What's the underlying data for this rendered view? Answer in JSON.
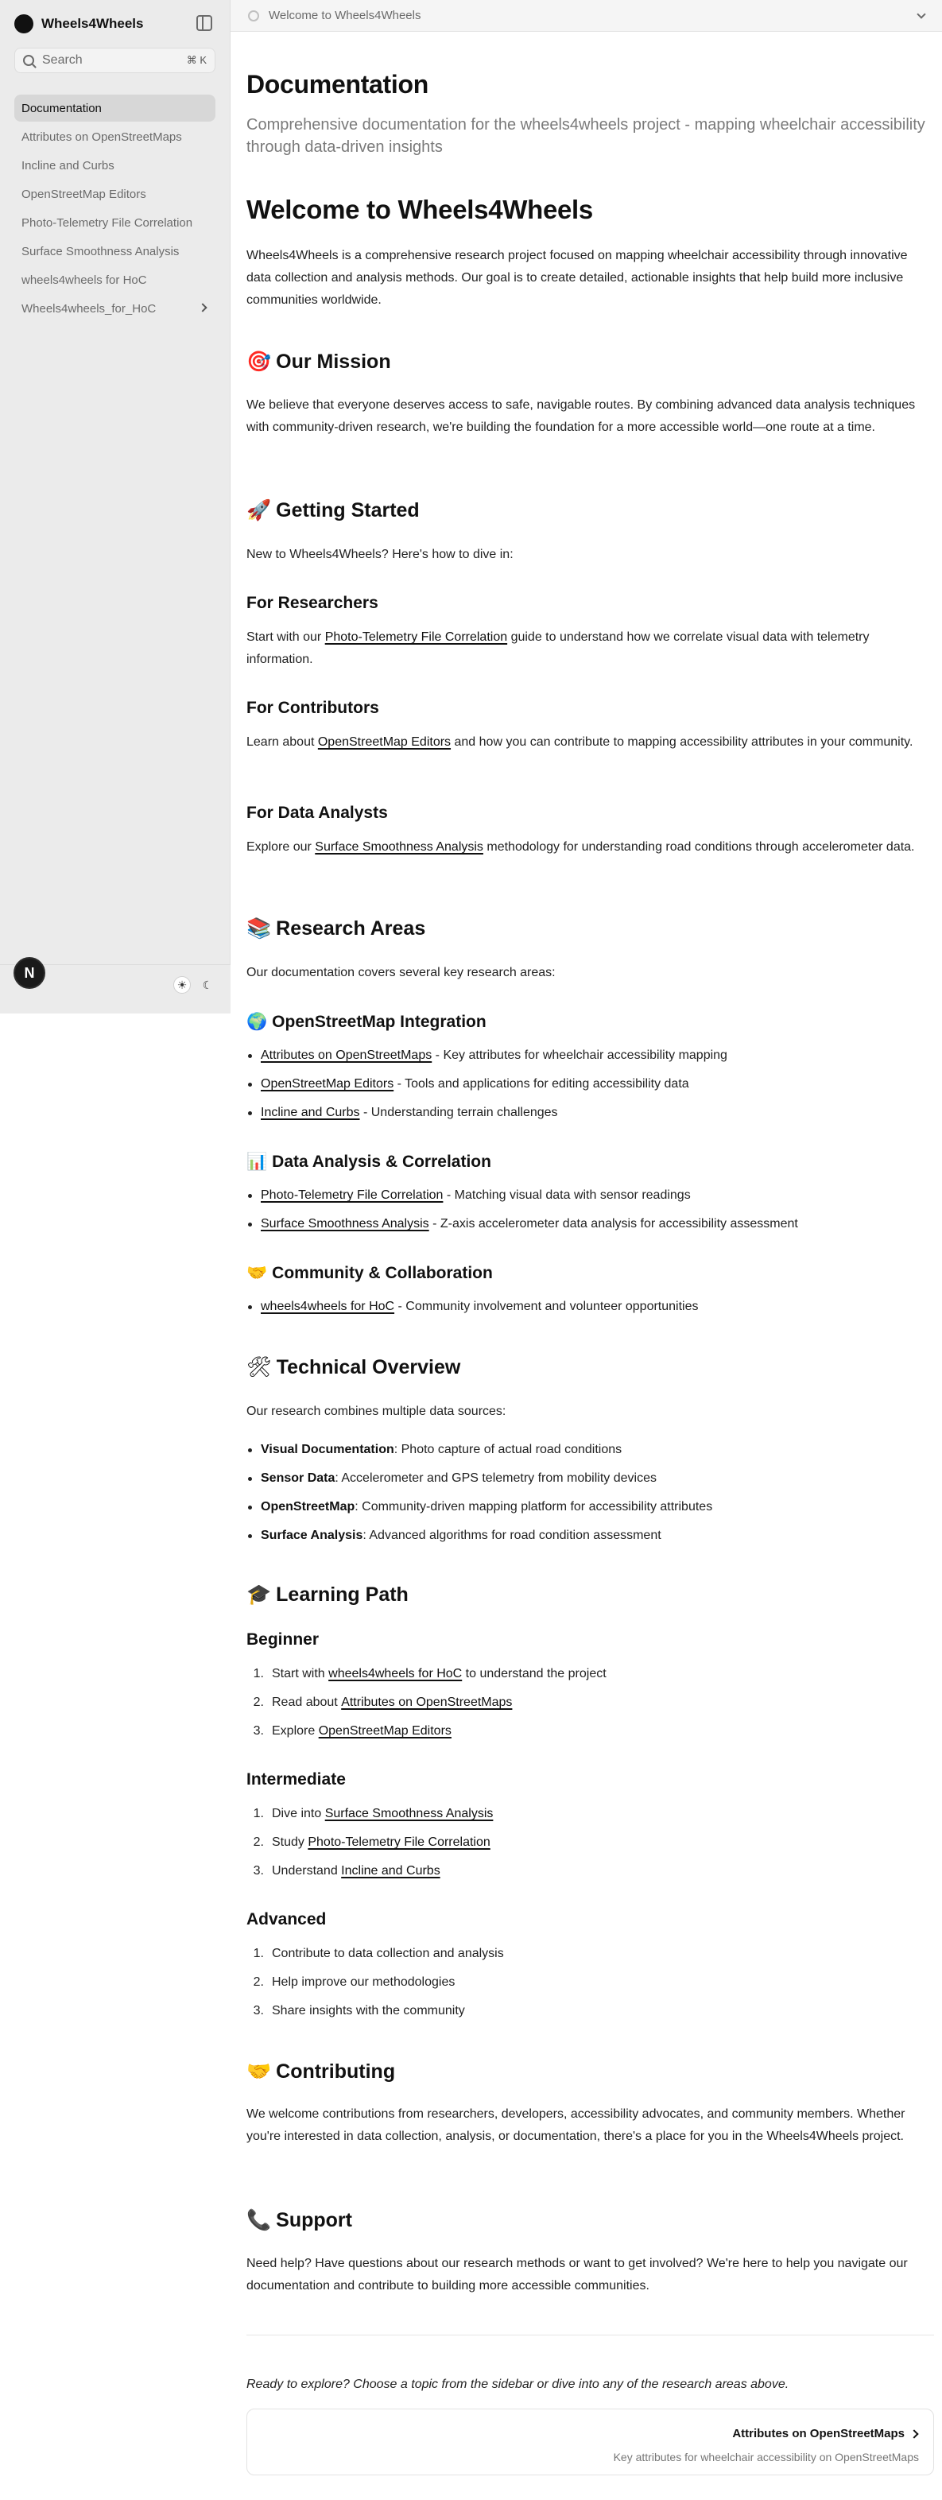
{
  "sidebar": {
    "brand": "Wheels4Wheels",
    "search_placeholder": "Search",
    "search_kbd": "⌘ K",
    "items": [
      {
        "label": "Documentation"
      },
      {
        "label": "Attributes on OpenStreetMaps"
      },
      {
        "label": "Incline and Curbs"
      },
      {
        "label": "OpenStreetMap Editors"
      },
      {
        "label": "Photo-Telemetry File Correlation"
      },
      {
        "label": "Surface Smoothness Analysis"
      },
      {
        "label": "wheels4wheels for HoC"
      },
      {
        "label": "Wheels4wheels_for_HoC"
      }
    ],
    "avatar_letter": "N"
  },
  "topbar": {
    "title": "Welcome to Wheels4Wheels"
  },
  "page": {
    "title": "Documentation",
    "subtitle": "Comprehensive documentation for the wheels4wheels project - mapping wheelchair accessibility through data-driven insights",
    "welcome_heading": "Welcome to Wheels4Wheels",
    "welcome_text": "Wheels4Wheels is a comprehensive research project focused on mapping wheelchair accessibility through innovative data collection and analysis methods. Our goal is to create detailed, actionable insights that help build more inclusive communities worldwide.",
    "mission": {
      "emoji": "🎯",
      "heading": "Our Mission",
      "text": "We believe that everyone deserves access to safe, navigable routes. By combining advanced data analysis techniques with community-driven research, we're building the foundation for a more accessible world—one route at a time."
    },
    "getting_started": {
      "emoji": "🚀",
      "heading": "Getting Started",
      "intro": "New to Wheels4Wheels? Here's how to dive in:",
      "researchers": {
        "heading": "For Researchers",
        "before": "Start with our ",
        "link": "Photo-Telemetry File Correlation",
        "after": " guide to understand how we correlate visual data with telemetry information."
      },
      "contributors": {
        "heading": "For Contributors",
        "before": "Learn about ",
        "link": "OpenStreetMap Editors",
        "after": " and how you can contribute to mapping accessibility attributes in your community."
      },
      "analysts": {
        "heading": "For Data Analysts",
        "before": "Explore our ",
        "link": "Surface Smoothness Analysis",
        "after": " methodology for understanding road conditions through accelerometer data."
      }
    },
    "research": {
      "emoji": "📚",
      "heading": "Research Areas",
      "intro": "Our documentation covers several key research areas:",
      "osm": {
        "emoji": "🌍",
        "heading": "OpenStreetMap Integration",
        "items": [
          {
            "link": "Attributes on OpenStreetMaps",
            "text": " - Key attributes for wheelchair accessibility mapping"
          },
          {
            "link": "OpenStreetMap Editors",
            "text": " - Tools and applications for editing accessibility data"
          },
          {
            "link": "Incline and Curbs",
            "text": " - Understanding terrain challenges"
          }
        ]
      },
      "data": {
        "emoji": "📊",
        "heading": "Data Analysis & Correlation",
        "items": [
          {
            "link": "Photo-Telemetry File Correlation",
            "text": " - Matching visual data with sensor readings"
          },
          {
            "link": "Surface Smoothness Analysis",
            "text": " - Z-axis accelerometer data analysis for accessibility assessment"
          }
        ]
      },
      "community": {
        "emoji": "🤝",
        "heading": "Community & Collaboration",
        "items": [
          {
            "link": "wheels4wheels for HoC",
            "text": " - Community involvement and volunteer opportunities"
          }
        ]
      }
    },
    "technical": {
      "emoji": "🛠",
      "heading": "Technical Overview",
      "intro": "Our research combines multiple data sources:",
      "items": [
        {
          "bold": "Visual Documentation",
          "text": ": Photo capture of actual road conditions"
        },
        {
          "bold": "Sensor Data",
          "text": ": Accelerometer and GPS telemetry from mobility devices"
        },
        {
          "bold": "OpenStreetMap",
          "text": ": Community-driven mapping platform for accessibility attributes"
        },
        {
          "bold": "Surface Analysis",
          "text": ": Advanced algorithms for road condition assessment"
        }
      ]
    },
    "learning": {
      "emoji": "🎓",
      "heading": "Learning Path",
      "beginner": {
        "heading": "Beginner",
        "items": [
          {
            "num": "1.",
            "before": "Start with ",
            "link": "wheels4wheels for HoC",
            "after": " to understand the project"
          },
          {
            "num": "2.",
            "before": "Read about ",
            "link": "Attributes on OpenStreetMaps",
            "after": ""
          },
          {
            "num": "3.",
            "before": "Explore ",
            "link": "OpenStreetMap Editors",
            "after": ""
          }
        ]
      },
      "intermediate": {
        "heading": "Intermediate",
        "items": [
          {
            "num": "1.",
            "before": "Dive into ",
            "link": "Surface Smoothness Analysis",
            "after": ""
          },
          {
            "num": "2.",
            "before": "Study ",
            "link": "Photo-Telemetry File Correlation",
            "after": ""
          },
          {
            "num": "3.",
            "before": "Understand ",
            "link": "Incline and Curbs",
            "after": ""
          }
        ]
      },
      "advanced": {
        "heading": "Advanced",
        "items": [
          {
            "num": "1.",
            "text": "Contribute to data collection and analysis"
          },
          {
            "num": "2.",
            "text": "Help improve our methodologies"
          },
          {
            "num": "3.",
            "text": "Share insights with the community"
          }
        ]
      }
    },
    "contributing": {
      "emoji": "🤝",
      "heading": "Contributing",
      "text": "We welcome contributions from researchers, developers, accessibility advocates, and community members. Whether you're interested in data collection, analysis, or documentation, there's a place for you in the Wheels4Wheels project."
    },
    "support": {
      "emoji": "📞",
      "heading": "Support",
      "text": "Need help? Have questions about our research methods or want to get involved? We're here to help you navigate our documentation and contribute to building more accessible communities."
    },
    "closing": "Ready to explore? Choose a topic from the sidebar or dive into any of the research areas above.",
    "next": {
      "title": "Attributes on OpenStreetMaps",
      "desc": "Key attributes for wheelchair accessibility on OpenStreetMaps"
    }
  }
}
